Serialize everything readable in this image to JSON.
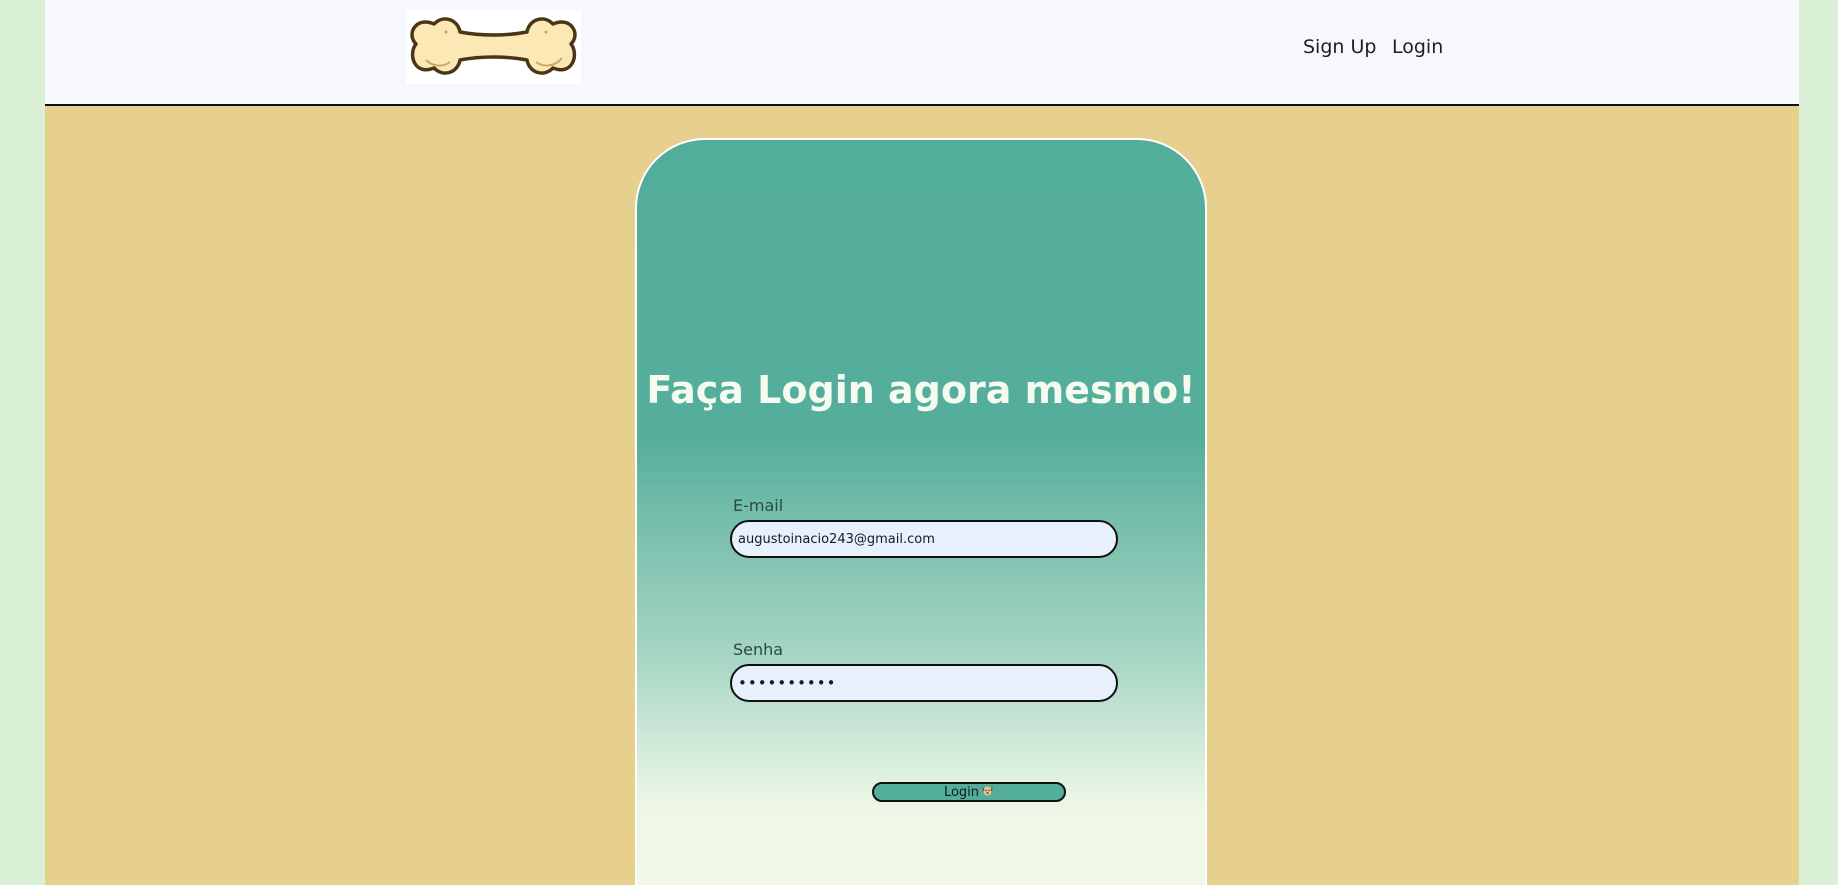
{
  "header": {
    "logo_icon": "bone-icon",
    "nav": {
      "signup_label": "Sign Up",
      "login_label": "Login"
    }
  },
  "login_card": {
    "title": "Faça Login agora mesmo!",
    "email": {
      "label": "E-mail",
      "value": "augustoinacio243@gmail.com"
    },
    "password": {
      "label": "Senha",
      "value": "••••••••••"
    },
    "submit": {
      "label": "Login",
      "icon": "dog-icon"
    }
  },
  "colors": {
    "header_bg": "#f7f8fe",
    "page_bg": "#e7cf8d",
    "outer_bg": "#d9f0d6",
    "card_top": "#53ad9b",
    "card_bottom": "#f1f8e9",
    "input_bg": "#e8f0fe",
    "button_bg": "#53ad9b"
  }
}
